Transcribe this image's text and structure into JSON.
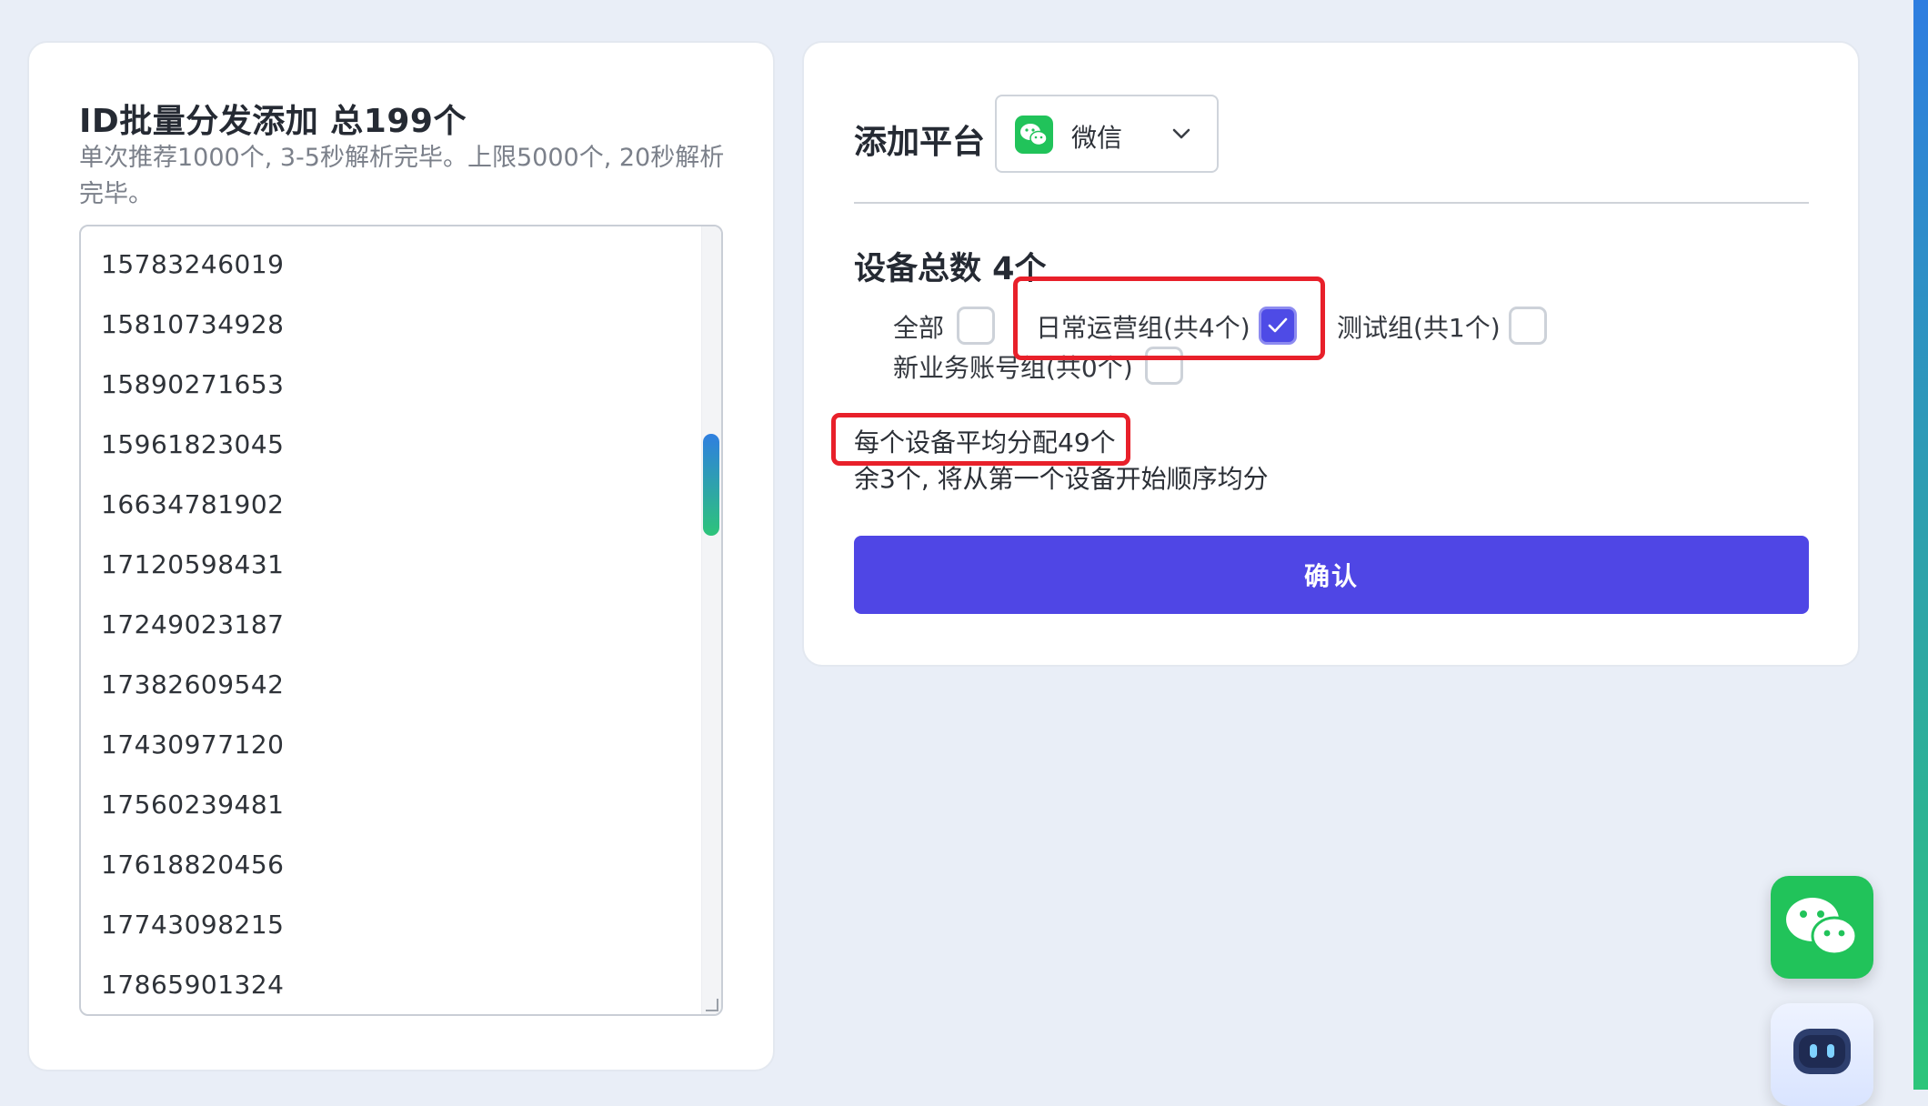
{
  "left_panel": {
    "title": "ID批量分发添加 总199个",
    "description": "单次推荐1000个, 3-5秒解析完毕。上限5000个, 20秒解析完毕。",
    "ids": [
      "15783246019",
      "15810734928",
      "15890271653",
      "15961823045",
      "16634781902",
      "17120598431",
      "17249023187",
      "17382609542",
      "17430977120",
      "17560239481",
      "17618820456",
      "17743098215",
      "17865901324"
    ]
  },
  "right_panel": {
    "platform_label": "添加平台",
    "platform_selected": "微信",
    "device_total": "设备总数 4个",
    "groups": [
      {
        "label": "全部",
        "checked": false
      },
      {
        "label": "日常运营组(共4个)",
        "checked": true
      },
      {
        "label": "测试组(共1个)",
        "checked": false
      },
      {
        "label": "新业务账号组(共0个)",
        "checked": false
      }
    ],
    "avg_text": "每个设备平均分配49个",
    "remain_text": "余3个, 将从第一个设备开始顺序均分",
    "confirm_label": "确认"
  },
  "colors": {
    "primary": "#4f46e5",
    "wechat_green": "#21c35a",
    "highlight_red": "#e8202a"
  },
  "icons": {
    "platform": "wechat-icon",
    "dropdown": "chevron-down-icon",
    "check": "check-icon",
    "fab1": "wechat-icon",
    "fab2": "robot-icon"
  }
}
